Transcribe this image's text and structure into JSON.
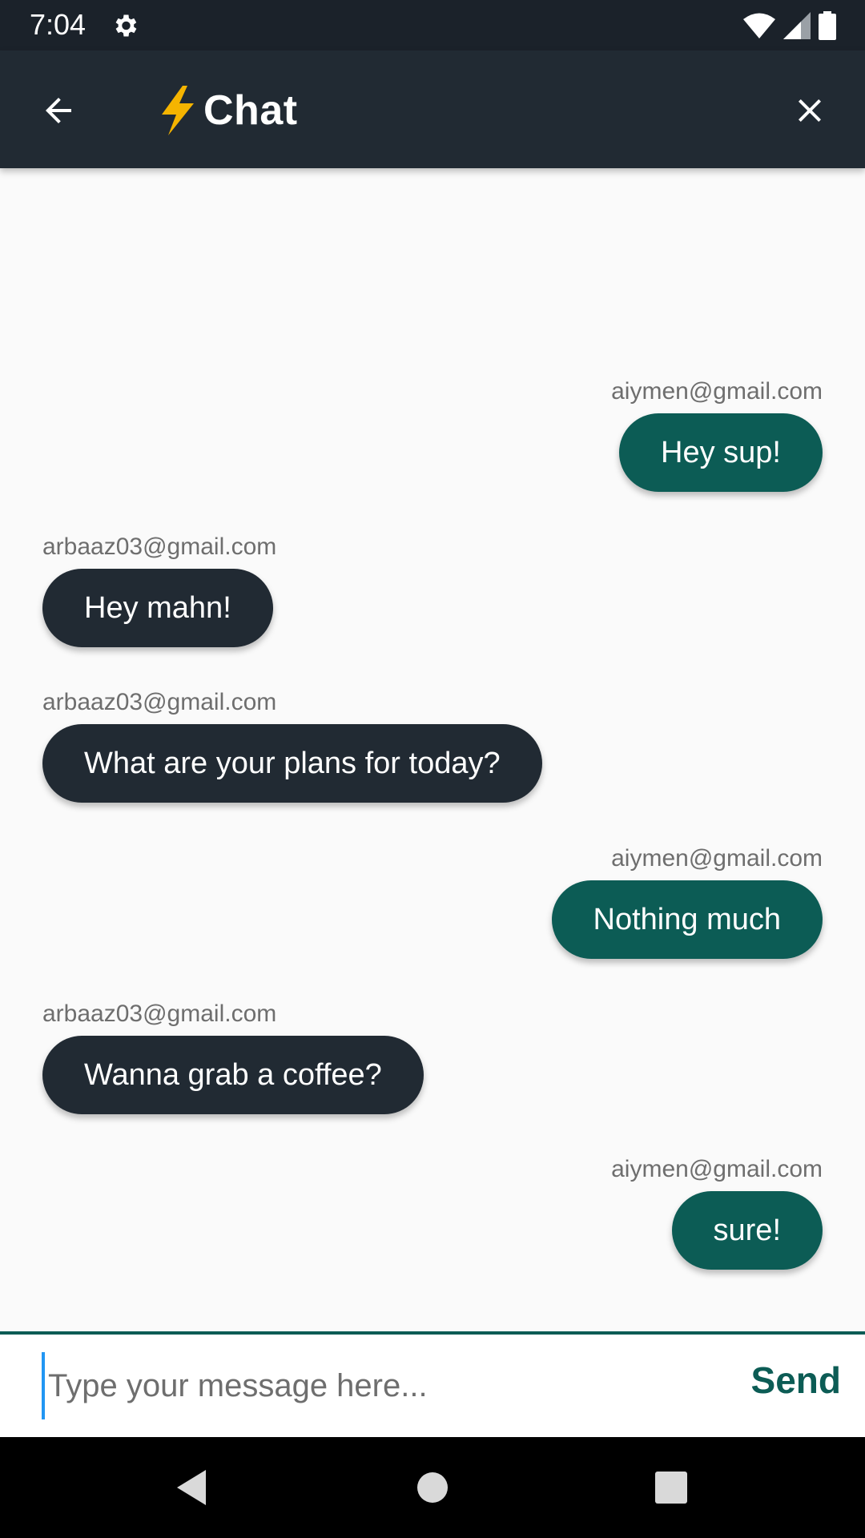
{
  "status_bar": {
    "time": "7:04",
    "icons": [
      "gear-icon",
      "wifi-icon",
      "signal-icon",
      "battery-icon"
    ]
  },
  "app_bar": {
    "title": "Chat",
    "title_emoji": "lightning-bolt-icon",
    "background": "#212a33"
  },
  "messages": [
    {
      "sender": "aiymen@gmail.com",
      "text": "Hey sup!",
      "side": "right"
    },
    {
      "sender": "arbaaz03@gmail.com",
      "text": "Hey mahn!",
      "side": "left"
    },
    {
      "sender": "arbaaz03@gmail.com",
      "text": "What are your plans for today?",
      "side": "left"
    },
    {
      "sender": "aiymen@gmail.com",
      "text": "Nothing much",
      "side": "right"
    },
    {
      "sender": "arbaaz03@gmail.com",
      "text": "Wanna grab a coffee?",
      "side": "left"
    },
    {
      "sender": "aiymen@gmail.com",
      "text": "sure!",
      "side": "right"
    }
  ],
  "composer": {
    "placeholder": "Type your message here...",
    "value": "",
    "send_label": "Send"
  },
  "colors": {
    "my_bubble": "#0c5c55",
    "their_bubble": "#212a33",
    "accent": "#0c5c55"
  }
}
